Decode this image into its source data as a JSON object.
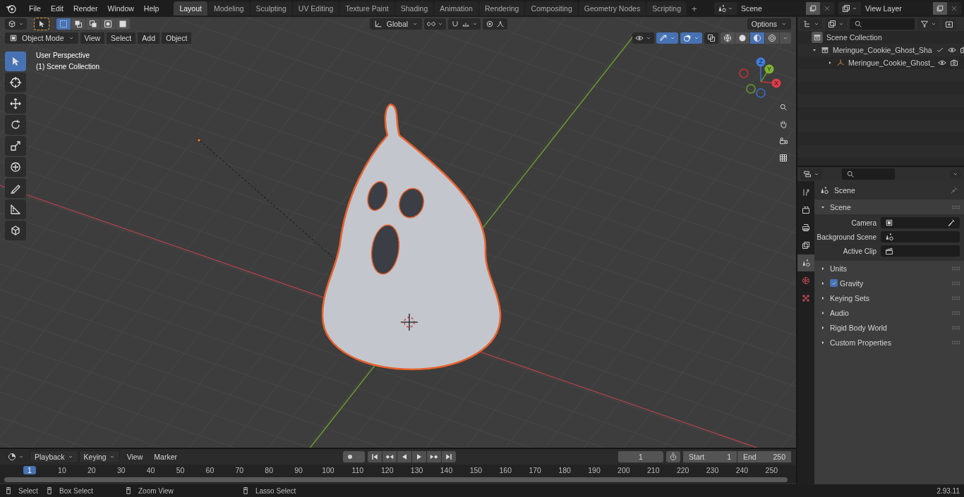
{
  "menu_bar": {
    "menus": [
      "File",
      "Edit",
      "Render",
      "Window",
      "Help"
    ]
  },
  "workspace_tabs": [
    {
      "label": "Layout",
      "selected": true
    },
    {
      "label": "Modeling",
      "selected": false
    },
    {
      "label": "Sculpting",
      "selected": false
    },
    {
      "label": "UV Editing",
      "selected": false
    },
    {
      "label": "Texture Paint",
      "selected": false
    },
    {
      "label": "Shading",
      "selected": false
    },
    {
      "label": "Animation",
      "selected": false
    },
    {
      "label": "Rendering",
      "selected": false
    },
    {
      "label": "Compositing",
      "selected": false
    },
    {
      "label": "Geometry Nodes",
      "selected": false
    },
    {
      "label": "Scripting",
      "selected": false
    }
  ],
  "add_tab": "+",
  "scene_selector": {
    "value": "Scene"
  },
  "view_layer_selector": {
    "value": "View Layer"
  },
  "viewport": {
    "mode": "Object Mode",
    "menus": [
      "View",
      "Select",
      "Add",
      "Object"
    ],
    "orientation": "Global",
    "options": "Options",
    "info": [
      "User Perspective",
      "(1) Scene Collection"
    ],
    "tools": [
      {
        "kind": "select",
        "selected": true
      },
      {
        "kind": "cursor",
        "selected": false
      },
      {
        "kind": "move",
        "selected": false
      },
      {
        "kind": "rotate",
        "selected": false
      },
      {
        "kind": "scale",
        "selected": false
      },
      {
        "kind": "transform",
        "selected": false
      },
      {
        "kind": "annotate",
        "selected": false
      },
      {
        "kind": "measure",
        "selected": false
      },
      {
        "kind": "add-cube",
        "selected": false
      }
    ],
    "gizmo_axes": [
      "X",
      "Y",
      "Z"
    ],
    "select_modes": [
      {
        "kind": "new",
        "selected": true
      },
      {
        "kind": "extend",
        "selected": false
      },
      {
        "kind": "subtract",
        "selected": false
      },
      {
        "kind": "invert",
        "selected": false
      },
      {
        "kind": "intersect",
        "selected": false
      }
    ],
    "shading_modes": [
      {
        "kind": "wireframe",
        "selected": false
      },
      {
        "kind": "solid",
        "selected": false
      },
      {
        "kind": "material",
        "selected": true
      },
      {
        "kind": "rendered",
        "selected": false
      }
    ],
    "toggles": {
      "proportional_edit": false,
      "gizmos": true,
      "overlays": true,
      "xray": false
    }
  },
  "outliner": {
    "root": "Scene Collection",
    "items": [
      {
        "label": "Meringue_Cookie_Ghost_Sha",
        "expanded": true,
        "children": [
          {
            "label": "Meringue_Cookie_Ghost_",
            "expanded": false
          }
        ]
      }
    ]
  },
  "properties": {
    "tabs": [
      {
        "kind": "tool",
        "selected": false
      },
      {
        "kind": "render",
        "selected": false
      },
      {
        "kind": "output",
        "selected": false
      },
      {
        "kind": "view-layer",
        "selected": false
      },
      {
        "kind": "scene",
        "selected": true
      },
      {
        "kind": "world",
        "selected": false
      },
      {
        "kind": "texture",
        "selected": false
      }
    ],
    "context": "Scene",
    "panels": [
      {
        "title": "Scene",
        "kind": "plain",
        "expanded": true,
        "fields": [
          {
            "label": "Camera"
          },
          {
            "label": "Background Scene"
          },
          {
            "label": "Active Clip"
          }
        ]
      },
      {
        "title": "Units",
        "kind": "plain",
        "expanded": false
      },
      {
        "title": "Gravity",
        "kind": "checkbox",
        "expanded": false,
        "checked": true
      },
      {
        "title": "Keying Sets",
        "kind": "plain",
        "expanded": false
      },
      {
        "title": "Audio",
        "kind": "plain",
        "expanded": false
      },
      {
        "title": "Rigid Body World",
        "kind": "plain",
        "expanded": false
      },
      {
        "title": "Custom Properties",
        "kind": "plain",
        "expanded": false
      }
    ]
  },
  "timeline": {
    "menus": [
      "Playback",
      "Keying",
      "View",
      "Marker"
    ],
    "auto_keying": false,
    "frame": "1",
    "start": {
      "label": "Start",
      "value": "1"
    },
    "end": {
      "label": "End",
      "value": "250"
    },
    "current_frame": "1",
    "ruler": [
      "10",
      "20",
      "30",
      "40",
      "50",
      "60",
      "70",
      "80",
      "90",
      "100",
      "110",
      "120",
      "130",
      "140",
      "150",
      "160",
      "170",
      "180",
      "190",
      "200",
      "210",
      "220",
      "230",
      "240",
      "250"
    ]
  },
  "status_bar": {
    "hints": [
      "Select",
      "Box Select",
      "Zoom View",
      "Lasso Select"
    ],
    "version": "2.93.11"
  }
}
